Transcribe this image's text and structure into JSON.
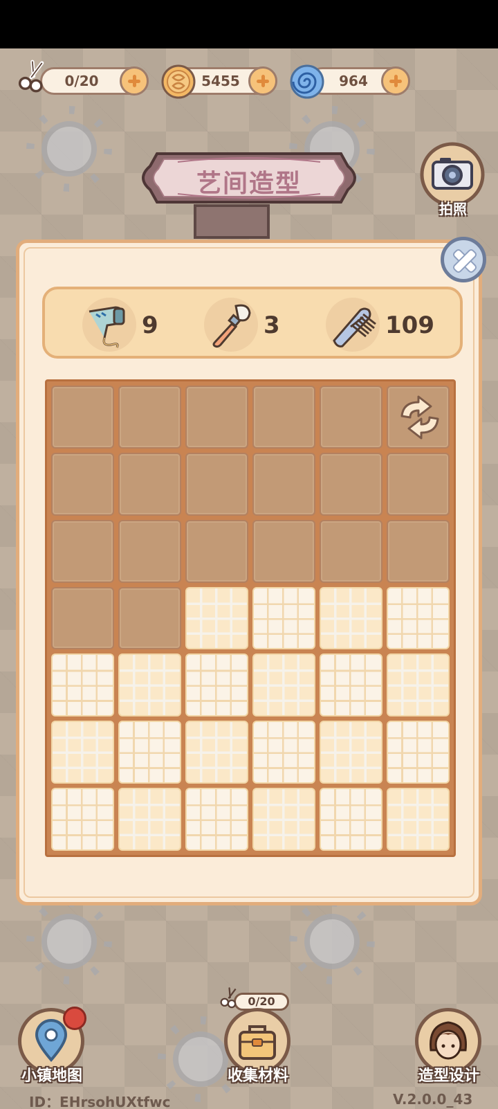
{
  "currencies": {
    "scissors": {
      "value": "0/20",
      "icon": "scissors-icon"
    },
    "coins": {
      "value": "5455",
      "icon": "coin-icon"
    },
    "gems": {
      "value": "964",
      "icon": "swirl-gem-icon"
    }
  },
  "title": "艺间造型",
  "camera": {
    "label": "拍照"
  },
  "tools": [
    {
      "name": "hair-dryer",
      "count": "9"
    },
    {
      "name": "makeup-brush",
      "count": "3"
    },
    {
      "name": "comb",
      "count": "109"
    }
  ],
  "grid": {
    "columns": 6,
    "rows": 7,
    "unlocked_rows": [
      [
        false,
        false,
        false,
        false,
        false,
        false
      ],
      [
        false,
        false,
        false,
        false,
        false,
        false
      ],
      [
        false,
        false,
        false,
        false,
        false,
        false
      ],
      [
        false,
        false,
        true,
        true,
        true,
        true
      ],
      [
        true,
        true,
        true,
        true,
        true,
        true
      ],
      [
        true,
        true,
        true,
        true,
        true,
        true
      ],
      [
        true,
        true,
        true,
        true,
        true,
        true
      ]
    ]
  },
  "bottom_nav": {
    "map_label": "小镇地图",
    "collect_label": "收集材料",
    "collect_counter": "0/20",
    "design_label": "造型设计"
  },
  "footer": {
    "id_text": "ID：EHrsohUXtfwc",
    "version": "V.2.0.0_43"
  },
  "colors": {
    "panel": "#fbecd9",
    "panel_border": "#e2ad7c",
    "locked_tile": "#c29a76",
    "grid_frame": "#c98452",
    "title_text": "#b07688"
  }
}
